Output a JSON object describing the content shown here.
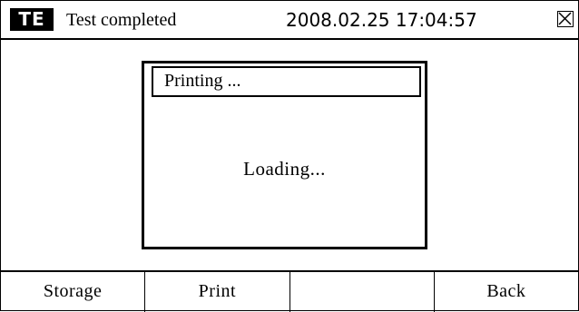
{
  "header": {
    "logo_text": "TE",
    "status": "Test completed",
    "datetime": "2008.02.25 17:04:57",
    "close_icon": "close-x-icon"
  },
  "dialog": {
    "title": "Printing ...",
    "message": "Loading..."
  },
  "softkeys": [
    {
      "label": "Storage"
    },
    {
      "label": "Print"
    },
    {
      "label": ""
    },
    {
      "label": "Back"
    }
  ]
}
